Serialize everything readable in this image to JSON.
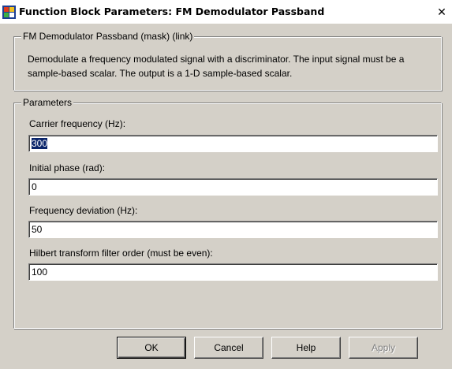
{
  "window": {
    "title": "Function Block Parameters: FM Demodulator Passband",
    "close_glyph": "✕",
    "app_icon": "simulink-block-icon"
  },
  "mask_group": {
    "legend": "FM Demodulator Passband (mask) (link)",
    "description": "Demodulate a frequency modulated signal with a discriminator. The input signal must be a sample-based scalar. The output is a 1-D sample-based scalar."
  },
  "parameters_group": {
    "legend": "Parameters",
    "fields": [
      {
        "label": "Carrier frequency (Hz):",
        "value": "300",
        "selected": true
      },
      {
        "label": "Initial phase (rad):",
        "value": "0",
        "selected": false
      },
      {
        "label": "Frequency deviation (Hz):",
        "value": "50",
        "selected": false
      },
      {
        "label": "Hilbert transform filter order (must be even):",
        "value": "100",
        "selected": false
      }
    ]
  },
  "buttons": {
    "ok": "OK",
    "cancel": "Cancel",
    "help": "Help",
    "apply": "Apply"
  },
  "colors": {
    "dialog_bg": "#d4d0c8",
    "selection_bg": "#0a246a"
  }
}
